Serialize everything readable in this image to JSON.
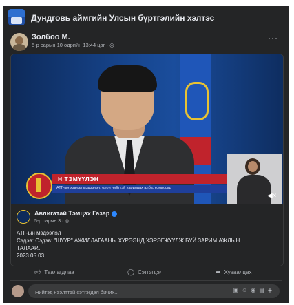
{
  "group": {
    "title": "Дундговь аймгийн Улсын бүртгэлийн хэлтэс"
  },
  "post": {
    "author": "Золбоо М.",
    "meta": "5-р сарын 10 өдрийн 13:44 цаг ·",
    "more_label": "···"
  },
  "video": {
    "lower_third_name": "Н ТЭМҮҮЛЭН",
    "lower_third_subtitle": "АТГ-ын хэвлэл мэдээлэл, олон нийттэй харилцах алба, комиссар"
  },
  "shared": {
    "page_name": "Авлигатай Тэмцэх Газар",
    "page_meta": "5-р сарын 3 ·",
    "text_lines": [
      "АТГ-ын мэдээлэл",
      "Сэдэв: Сэдэв: \"ШҮҮР\" АЖИЛЛАГААНЫ ХҮРЭЭНД ХЭРЭГЖҮҮЛЖ БУЙ ЗАРИМ АЖЛЫН",
      "ТАЛААР...",
      "2023.05.03"
    ]
  },
  "actions": {
    "like": "Таалагдлаа",
    "comment": "Сэтгэгдэл",
    "share": "Хуваалцах"
  },
  "comment_box": {
    "placeholder": "Нийтэд нээлттэй сэтгэгдэл бичих..."
  },
  "colors": {
    "background": "#242526",
    "accent_red": "#c0232c",
    "accent_blue": "#1f3f9a",
    "verified": "#2d88ff"
  }
}
